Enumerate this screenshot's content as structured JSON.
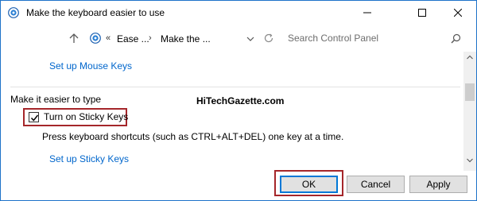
{
  "window": {
    "title": "Make the keyboard easier to use",
    "icon": "control-panel-icon"
  },
  "titlebar_buttons": [
    "minimize",
    "maximize",
    "close"
  ],
  "address_bar": {
    "separator": "«",
    "crumbs": [
      "Ease ...",
      "Make the ..."
    ],
    "arrow": "›",
    "search_placeholder": "Search Control Panel"
  },
  "content": {
    "mouse_keys_link": "Set up Mouse Keys",
    "section_title": "Make it easier to type",
    "watermark": "HiTechGazette.com",
    "sticky_keys": {
      "label": "Turn on Sticky Keys",
      "checked": true
    },
    "sticky_description": "Press keyboard shortcuts (such as CTRL+ALT+DEL) one key at a time.",
    "sticky_keys_link": "Set up Sticky Keys"
  },
  "buttons": {
    "ok": "OK",
    "cancel": "Cancel",
    "apply": "Apply"
  },
  "colors": {
    "link": "#0066cc",
    "highlight": "#a5262a",
    "window_border": "#1e73c9"
  }
}
